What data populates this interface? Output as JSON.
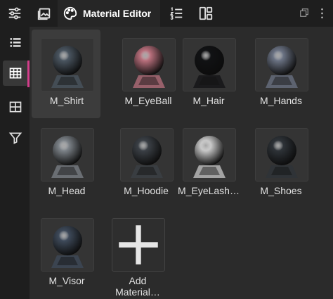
{
  "toolbar": {
    "tabs": [
      {
        "icon": "sliders-icon"
      },
      {
        "icon": "image-icon"
      },
      {
        "icon": "palette-icon",
        "label": "Material Editor",
        "active": true
      },
      {
        "icon": "numbered-list-icon"
      },
      {
        "icon": "layout-icon"
      }
    ],
    "window_icons": [
      "restore-window-icon",
      "more-options-icon"
    ]
  },
  "sidebar": {
    "items": [
      {
        "icon": "list-view-icon",
        "selected": false
      },
      {
        "icon": "grid-view-icon",
        "selected": true
      },
      {
        "icon": "large-grid-icon",
        "selected": false
      },
      {
        "icon": "filter-icon",
        "selected": false
      }
    ],
    "accent_color": "#d23d8a"
  },
  "materials": [
    {
      "name": "M_Shirt",
      "selected": true,
      "color": "#4a5560"
    },
    {
      "name": "M_EyeBall",
      "selected": false,
      "color": "#b86f7c"
    },
    {
      "name": "M_Hair",
      "selected": false,
      "color": "#111214"
    },
    {
      "name": "M_Hands",
      "selected": false,
      "color": "#6b7384"
    },
    {
      "name": "M_Head",
      "selected": false,
      "color": "#7c8288"
    },
    {
      "name": "M_Hoodie",
      "selected": false,
      "color": "#3b4046"
    },
    {
      "name": "M_EyeLash…",
      "selected": false,
      "color": "#c8c8c8"
    },
    {
      "name": "M_Shoes",
      "selected": false,
      "color": "#2e3338"
    },
    {
      "name": "M_Visor",
      "selected": false,
      "color": "#3e4a5a"
    }
  ],
  "add_material": {
    "label_line1": "Add",
    "label_line2": "Material…",
    "icon": "plus-icon"
  }
}
